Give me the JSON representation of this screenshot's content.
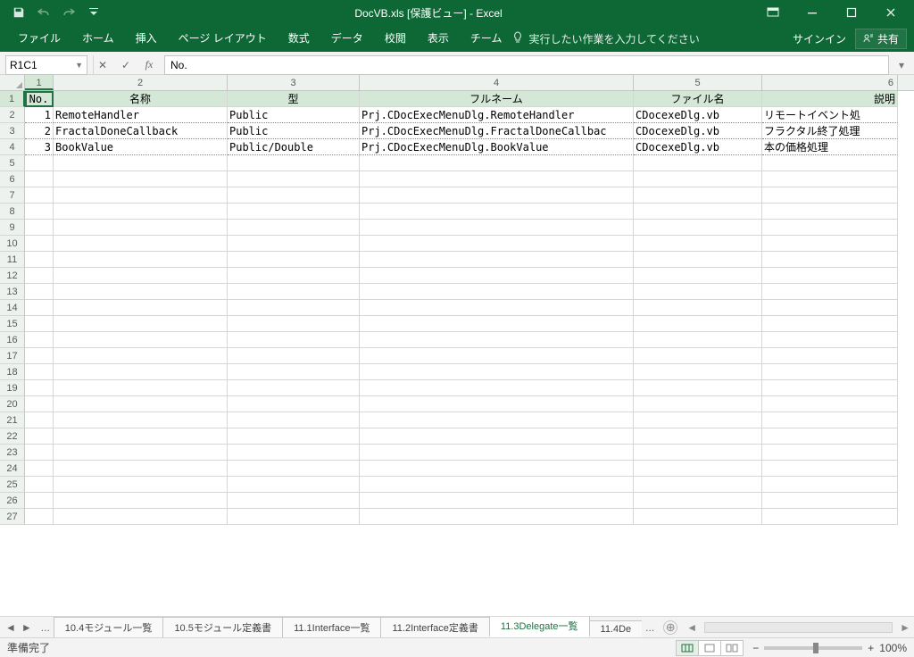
{
  "title": "DocVB.xls [保護ビュー] - Excel",
  "ribbon": {
    "tabs": [
      "ファイル",
      "ホーム",
      "挿入",
      "ページ レイアウト",
      "数式",
      "データ",
      "校閲",
      "表示",
      "チーム"
    ],
    "tellme": "実行したい作業を入力してください",
    "signin": "サインイン",
    "share": "共有"
  },
  "namebox": "R1C1",
  "formula": "No.",
  "colnums": [
    "1",
    "2",
    "3",
    "4",
    "5",
    "6"
  ],
  "headers": [
    "No.",
    "名称",
    "型",
    "フルネーム",
    "ファイル名",
    "説明"
  ],
  "data": [
    {
      "no": "1",
      "name": "RemoteHandler",
      "type": "Public",
      "full": "Prj.CDocExecMenuDlg.RemoteHandler",
      "file": "CDocexeDlg.vb",
      "desc": "リモートイベント処"
    },
    {
      "no": "2",
      "name": "FractalDoneCallback",
      "type": "Public",
      "full": "Prj.CDocExecMenuDlg.FractalDoneCallbac",
      "file": "CDocexeDlg.vb",
      "desc": "フラクタル終了処理"
    },
    {
      "no": "3",
      "name": "BookValue",
      "type": "Public/Double",
      "full": "Prj.CDocExecMenuDlg.BookValue",
      "file": "CDocexeDlg.vb",
      "desc": "本の価格処理"
    }
  ],
  "sheets": {
    "items": [
      "10.4モジュール一覧",
      "10.5モジュール定義書",
      "11.1Interface一覧",
      "11.2Interface定義書",
      "11.3Delegate一覧",
      "11.4De"
    ],
    "active": 4,
    "ellL": "...",
    "ellR": "..."
  },
  "status": {
    "ready": "準備完了",
    "zoom": "100%"
  }
}
